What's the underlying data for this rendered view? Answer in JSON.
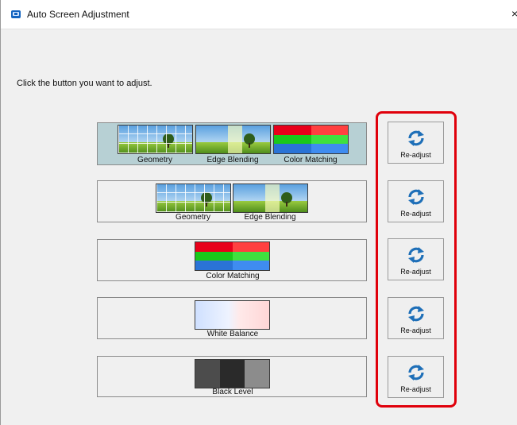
{
  "window": {
    "title": "Auto Screen Adjustment",
    "close_glyph": "×",
    "accent_color": "#e0000b"
  },
  "instruction": "Click the button you want to adjust.",
  "panels": [
    {
      "labels": [
        "Geometry",
        "Edge Blending",
        "Color Matching"
      ],
      "selected": true
    },
    {
      "labels": [
        "Geometry",
        "Edge Blending"
      ],
      "selected": false
    },
    {
      "labels": [
        "Color Matching"
      ],
      "selected": false
    },
    {
      "labels": [
        "White Balance"
      ],
      "selected": false
    },
    {
      "labels": [
        "Black Level"
      ],
      "selected": false
    }
  ],
  "readjust": {
    "label": "Re-adjust",
    "icon": "refresh-icon"
  }
}
